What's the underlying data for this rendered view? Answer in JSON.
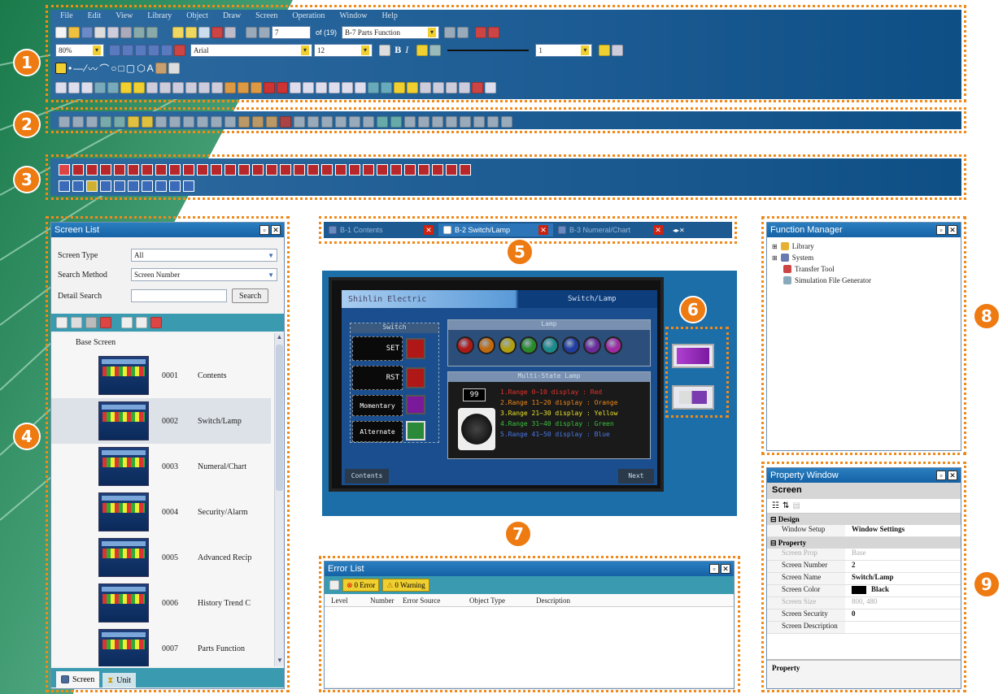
{
  "menu": [
    "File",
    "Edit",
    "View",
    "Library",
    "Object",
    "Draw",
    "Screen",
    "Operation",
    "Window",
    "Help"
  ],
  "toolbar": {
    "zoom": "80%",
    "font_name": "Arial",
    "font_size": "12",
    "page_input": "7",
    "page_total": "of (19)",
    "screen_select": "B-7 Parts Function",
    "line_width": "1"
  },
  "badges": [
    "1",
    "2",
    "3",
    "4",
    "5",
    "6",
    "7",
    "8",
    "9"
  ],
  "screen_list": {
    "title": "Screen List",
    "screen_type_label": "Screen Type",
    "screen_type_value": "All",
    "search_method_label": "Search Method",
    "search_method_value": "Screen Number",
    "detail_search_label": "Detail Search",
    "search_button": "Search",
    "group_label": "Base Screen",
    "items": [
      {
        "number": "0001",
        "name": "Contents"
      },
      {
        "number": "0002",
        "name": "Switch/Lamp"
      },
      {
        "number": "0003",
        "name": "Numeral/Chart"
      },
      {
        "number": "0004",
        "name": "Security/Alarm"
      },
      {
        "number": "0005",
        "name": "Advanced Recip"
      },
      {
        "number": "0006",
        "name": "History Trend C"
      },
      {
        "number": "0007",
        "name": "Parts Function"
      }
    ],
    "tab_screen": "Screen",
    "tab_unit": "Unit"
  },
  "editor_tabs": [
    {
      "label": "B-1 Contents"
    },
    {
      "label": "B-2 Switch/Lamp"
    },
    {
      "label": "B-3 Numeral/Chart"
    }
  ],
  "hmi": {
    "brand": "Shihlin Electric",
    "screen_title": "Switch/Lamp",
    "switch_header": "Switch",
    "lamp_header": "Lamp",
    "multistate_header": "Multi-State Lamp",
    "btn_set": "SET",
    "btn_rst": "RST",
    "btn_momentary": "Momentary",
    "btn_alternate": "Alternate",
    "ms_value": "99",
    "ranges": [
      "1.Range 0~10 display : Red",
      "2.Range 11~20 display : Orange",
      "3.Range 21~30 display : Yellow",
      "4.Range 31~40 display : Green",
      "5.Range 41~50 display : Blue"
    ],
    "range_colors": [
      "#e8322a",
      "#f08a1c",
      "#e8e02a",
      "#3cc03c",
      "#4a7ae8"
    ],
    "lamp_colors": [
      "#b01818",
      "#c06a10",
      "#b0a010",
      "#2a8a2a",
      "#1a8a8a",
      "#203ca0",
      "#6a2a9a",
      "#a02aa0"
    ],
    "btn_contents": "Contents",
    "btn_next": "Next"
  },
  "error_list": {
    "title": "Error List",
    "error_count": "0 Error",
    "warning_count": "0 Warning",
    "columns": [
      "Level",
      "Number",
      "Error Source",
      "Object Type",
      "Description"
    ]
  },
  "function_manager": {
    "title": "Function Manager",
    "items": [
      "Library",
      "System",
      "Transfer Tool",
      "Simulation File Generator"
    ]
  },
  "property_window": {
    "title": "Property Window",
    "object": "Screen",
    "cat_design": "Design",
    "cat_property": "Property",
    "rows_design": [
      {
        "key": "Window Setup",
        "value": "Window Settings",
        "disabled": false
      }
    ],
    "rows_property": [
      {
        "key": "Screen Prop",
        "value": "Base",
        "disabled": true
      },
      {
        "key": "Screen Number",
        "value": "2",
        "disabled": false
      },
      {
        "key": "Screen Name",
        "value": "Switch/Lamp",
        "disabled": false
      },
      {
        "key": "Screen Color",
        "value": "Black",
        "disabled": false
      },
      {
        "key": "Screen Size",
        "value": "800, 480",
        "disabled": true
      },
      {
        "key": "Screen Security",
        "value": "0",
        "disabled": false
      },
      {
        "key": "Screen Description",
        "value": "",
        "disabled": false
      }
    ],
    "footer": "Property"
  },
  "colors": {
    "accent": "#ee7a12",
    "toolbar_blue": "#1d5c94",
    "title_blue": "#1562a6"
  }
}
